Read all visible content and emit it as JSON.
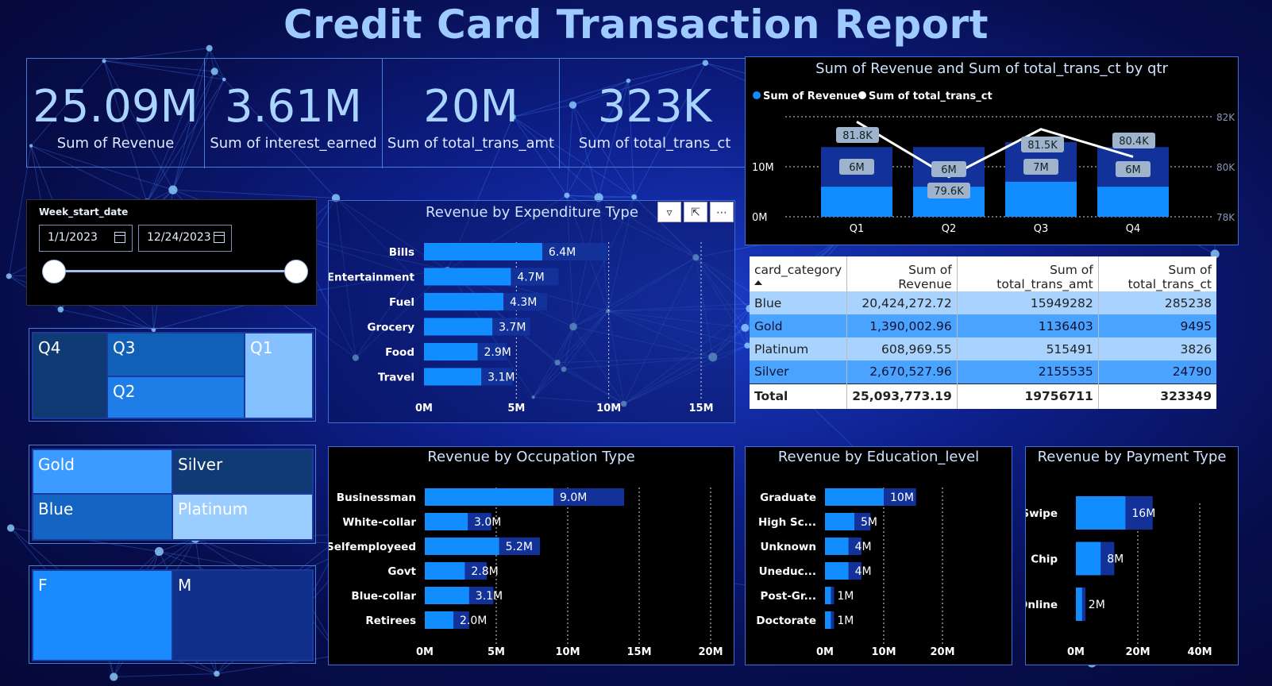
{
  "title": "Credit Card Transaction Report",
  "kpis": [
    {
      "value": "25.09M",
      "label": "Sum of Revenue"
    },
    {
      "value": "3.61M",
      "label": "Sum of interest_earned"
    },
    {
      "value": "20M",
      "label": "Sum of total_trans_amt"
    },
    {
      "value": "323K",
      "label": "Sum of total_trans_ct"
    }
  ],
  "slicer": {
    "label": "Week_start_date",
    "start": "1/1/2023",
    "end": "12/24/2023"
  },
  "treemap_quarter": [
    "Q4",
    "Q3",
    "Q2",
    "Q1"
  ],
  "treemap_card": [
    "Gold",
    "Silver",
    "Blue",
    "Platinum"
  ],
  "treemap_gender": [
    "F",
    "M"
  ],
  "visual_header_icons": [
    "filter-icon",
    "focus-mode-icon",
    "more-options-icon"
  ],
  "colors": {
    "bar_main": "#118dff",
    "bar_back": "#12329a",
    "title": "#9ecbff"
  },
  "chart_data": [
    {
      "type": "line",
      "title": "Sum of Revenue and Sum of total_trans_ct by qtr",
      "legend": [
        "Sum of Revenue",
        "Sum of total_trans_ct"
      ],
      "legend_position": "top-left",
      "categories": [
        "Q1",
        "Q2",
        "Q3",
        "Q4"
      ],
      "series": [
        {
          "name": "Sum of Revenue",
          "values": [
            6,
            6,
            7,
            6
          ],
          "labels": [
            "6M",
            "6M",
            "7M",
            "6M"
          ]
        },
        {
          "name": "Sum of total_trans_ct",
          "values": [
            81.8,
            79.6,
            81.5,
            80.4
          ],
          "labels": [
            "81.8K",
            "79.6K",
            "81.5K",
            "80.4K"
          ]
        }
      ],
      "y_left_ticks": [
        "0M",
        "10M"
      ],
      "y_right_ticks": [
        "78K",
        "80K",
        "82K"
      ]
    },
    {
      "type": "bar",
      "title": "Revenue by Expenditure Type",
      "categories": [
        "Bills",
        "Entertainment",
        "Fuel",
        "Grocery",
        "Food",
        "Travel"
      ],
      "values": [
        6.4,
        4.7,
        4.3,
        3.7,
        2.9,
        3.1
      ],
      "labels": [
        "6.4M",
        "4.7M",
        "4.3M",
        "3.7M",
        "2.9M",
        "3.1M"
      ],
      "x_ticks": [
        "0M",
        "5M",
        "10M",
        "15M"
      ],
      "xlim": [
        0,
        15
      ]
    },
    {
      "type": "bar",
      "title": "Revenue by Occupation Type",
      "categories": [
        "Businessman",
        "White-collar",
        "Selfemployeed",
        "Govt",
        "Blue-collar",
        "Retirees"
      ],
      "values": [
        9.0,
        3.0,
        5.2,
        2.8,
        3.1,
        2.0
      ],
      "labels": [
        "9.0M",
        "3.0M",
        "5.2M",
        "2.8M",
        "3.1M",
        "2.0M"
      ],
      "x_ticks": [
        "0M",
        "5M",
        "10M",
        "15M",
        "20M"
      ],
      "xlim": [
        0,
        20
      ]
    },
    {
      "type": "bar",
      "title": "Revenue by Education_level",
      "categories": [
        "Graduate",
        "High Sc...",
        "Unknown",
        "Uneduc...",
        "Post-Gr...",
        "Doctorate"
      ],
      "values": [
        10,
        5,
        4,
        4,
        1,
        1
      ],
      "labels": [
        "10M",
        "5M",
        "4M",
        "4M",
        "1M",
        "1M"
      ],
      "x_ticks": [
        "0M",
        "10M",
        "20M"
      ],
      "xlim": [
        0,
        20
      ]
    },
    {
      "type": "bar",
      "title": "Revenue by Payment Type",
      "categories": [
        "Swipe",
        "Chip",
        "Online"
      ],
      "values": [
        16,
        8,
        2
      ],
      "labels": [
        "16M",
        "8M",
        "2M"
      ],
      "x_ticks": [
        "0M",
        "20M",
        "40M"
      ],
      "xlim": [
        0,
        40
      ]
    },
    {
      "type": "table",
      "columns": [
        "card_category",
        "Sum of Revenue",
        "Sum of total_trans_amt",
        "Sum of total_trans_ct"
      ],
      "rows": [
        [
          "Blue",
          "20,424,272.72",
          "15949282",
          "285238"
        ],
        [
          "Gold",
          "1,390,002.96",
          "1136403",
          "9495"
        ],
        [
          "Platinum",
          "608,969.55",
          "515491",
          "3826"
        ],
        [
          "Silver",
          "2,670,527.96",
          "2155535",
          "24790"
        ]
      ],
      "total": [
        "Total",
        "25,093,773.19",
        "19756711",
        "323349"
      ]
    }
  ]
}
